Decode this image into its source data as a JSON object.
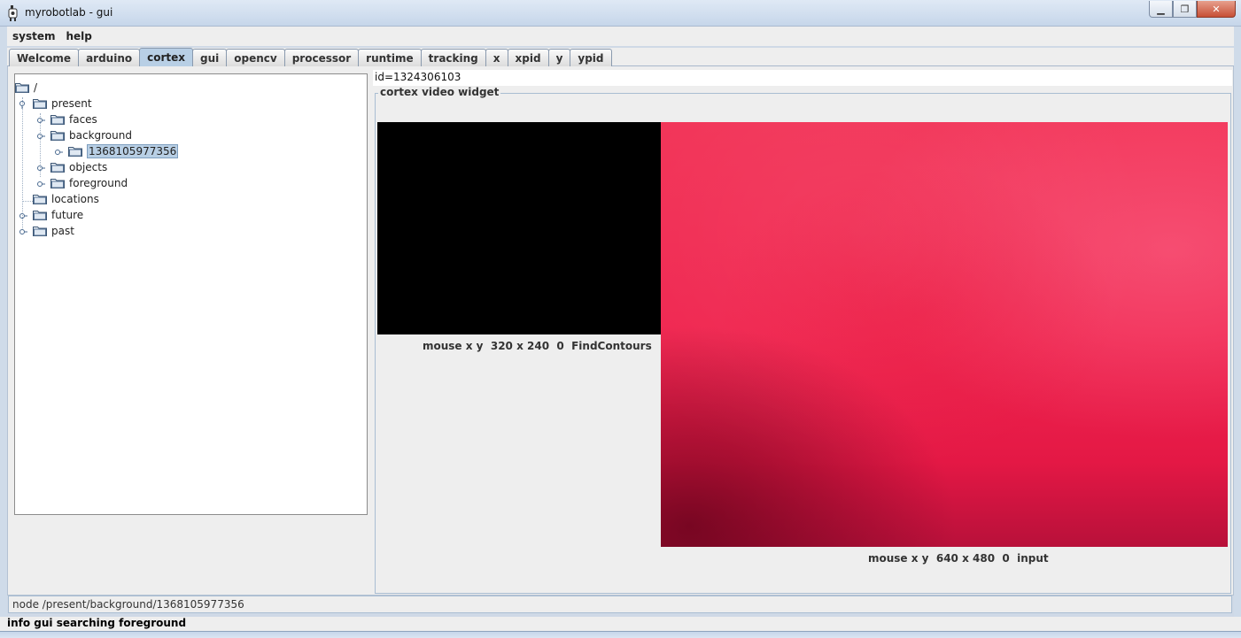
{
  "window": {
    "title": "myrobotlab - gui",
    "buttons": {
      "minimize": "▁",
      "maximize": "❐",
      "close": "✕"
    }
  },
  "menu": [
    "system",
    "help"
  ],
  "tabs": {
    "items": [
      "Welcome",
      "arduino",
      "cortex",
      "gui",
      "opencv",
      "processor",
      "runtime",
      "tracking",
      "x",
      "xpid",
      "y",
      "ypid"
    ],
    "active": "cortex"
  },
  "tree": {
    "root": "/",
    "present": "present",
    "faces": "faces",
    "background": "background",
    "background_child": "1368105977356",
    "objects": "objects",
    "foreground": "foreground",
    "locations": "locations",
    "future": "future",
    "past": "past"
  },
  "panel": {
    "id": "id=1324306103",
    "group_title": "cortex  video widget",
    "small_caption": "mouse x y  320 x 240  0  FindContours",
    "big_caption": "mouse x y  640 x 480  0  input"
  },
  "node_status": "node /present/background/1368105977356",
  "status": "info gui searching foreground",
  "colors": {
    "tab_active": "#b8cfe5",
    "video_red": "#f02650",
    "video_black": "#000000"
  }
}
